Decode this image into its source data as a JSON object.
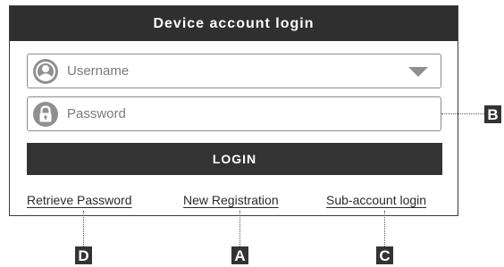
{
  "dialog": {
    "title": "Device account login"
  },
  "username": {
    "placeholder": "Username",
    "icon": "user-avatar-icon"
  },
  "password": {
    "placeholder": "Password",
    "icon": "lock-icon"
  },
  "login_button": {
    "label": "LOGIN"
  },
  "links": {
    "retrieve_password": "Retrieve Password",
    "new_registration": "New Registration",
    "sub_account_login": "Sub-account login"
  },
  "callouts": {
    "a": "A",
    "b": "B",
    "c": "C",
    "d": "D"
  },
  "colors": {
    "header": "#2f2f2f",
    "button": "#333333",
    "icon": "#8f8f8f"
  }
}
